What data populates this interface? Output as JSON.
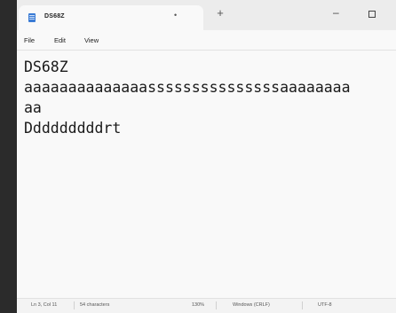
{
  "tab": {
    "title": "DS68Z",
    "modified_indicator": "•",
    "new_tab_label": "+"
  },
  "window_controls": {
    "minimize": "–"
  },
  "menu": {
    "file": "File",
    "edit": "Edit",
    "view": "View"
  },
  "editor": {
    "lines": [
      "DS68Z",
      "aaaaaaaaaaaaaasssssssssssssssaaaaaaaa",
      "aa",
      "Dddddddddrt"
    ]
  },
  "status": {
    "position": "Ln 3, Col 11",
    "characters": "54 characters",
    "zoom": "130%",
    "line_ending": "Windows (CRLF)",
    "encoding": "UTF-8"
  },
  "colors": {
    "background": "#2b2b2b",
    "window": "#f9f9f9",
    "titlebar": "#ececec",
    "accent": "#3a7bd5"
  }
}
